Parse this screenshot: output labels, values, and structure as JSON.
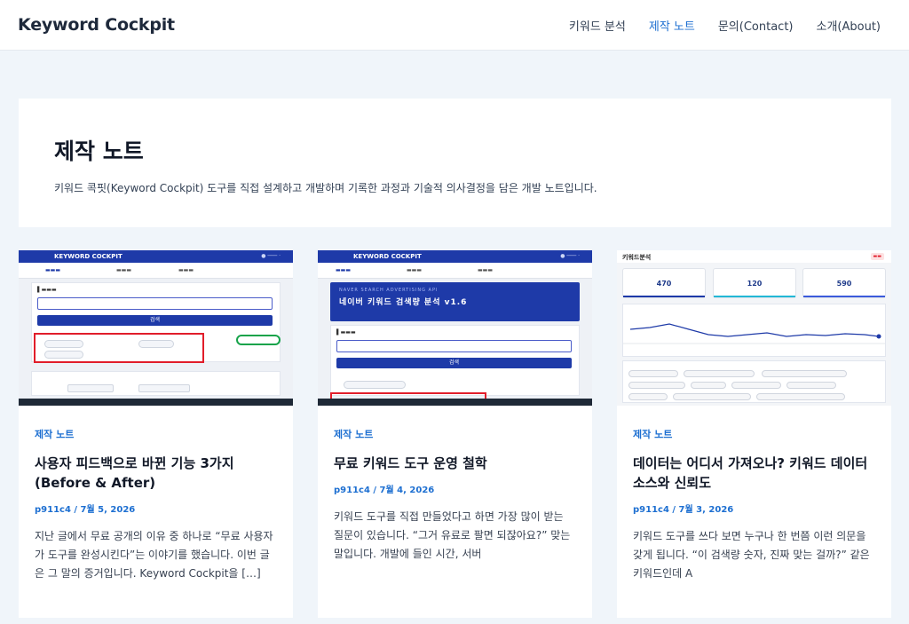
{
  "header": {
    "site_title": "Keyword Cockpit",
    "nav": [
      {
        "label": "키워드 분석",
        "active": false
      },
      {
        "label": "제작 노트",
        "active": true
      },
      {
        "label": "문의(Contact)",
        "active": false
      },
      {
        "label": "소개(About)",
        "active": false
      }
    ]
  },
  "intro": {
    "title": "제작 노트",
    "description": "키워드 콕핏(Keyword Cockpit) 도구를 직접 설계하고 개발하며 기록한 과정과 기술적 의사결정을 담은 개발 노트입니다."
  },
  "posts": [
    {
      "category": "제작 노트",
      "title": "사용자 피드백으로 바뀐 기능 3가지 (Before & After)",
      "meta": "p911c4 / 7월 5, 2026",
      "excerpt": "지난 글에서 무료 공개의 이유 중 하나로 “무료 사용자가 도구를 완성시킨다”는 이야기를 했습니다. 이번 글은 그 말의 증거입니다. Keyword Cockpit을 […]",
      "thumb": {
        "logo": "KEYWORD COCKPIT",
        "button": "검색"
      }
    },
    {
      "category": "제작 노트",
      "title": "무료 키워드 도구 운영 철학",
      "meta": "p911c4 / 7월 4, 2026",
      "excerpt": "키워드 도구를 직접 만들었다고 하면 가장 많이 받는 질문이 있습니다. “그거 유료로 팔면 되잖아요?” 맞는 말입니다. 개발에 들인 시간, 서버",
      "thumb": {
        "logo": "KEYWORD COCKPIT",
        "banner_sub": "NAVER SEARCH ADVERTISING API",
        "banner_title": "네이버 키워드 검색량 분석 v1.6",
        "button": "검색"
      }
    },
    {
      "category": "제작 노트",
      "title": "데이터는 어디서 가져오나? 키워드 데이터 소스와 신뢰도",
      "meta": "p911c4 / 7월 3, 2026",
      "excerpt": "키워드 도구를 쓰다 보면 누구나 한 번쯤 이런 의문을 갖게 됩니다. “이 검색량 숫자, 진짜 맞는 걸까?” 같은 키워드인데 A",
      "thumb": {
        "title": "키워드분석",
        "kpis": [
          "470",
          "120",
          "590"
        ]
      }
    }
  ],
  "colors": {
    "accent": "#1d6fd1",
    "mock_primary": "#1e3aa8",
    "highlight_red": "#e11d2a"
  }
}
